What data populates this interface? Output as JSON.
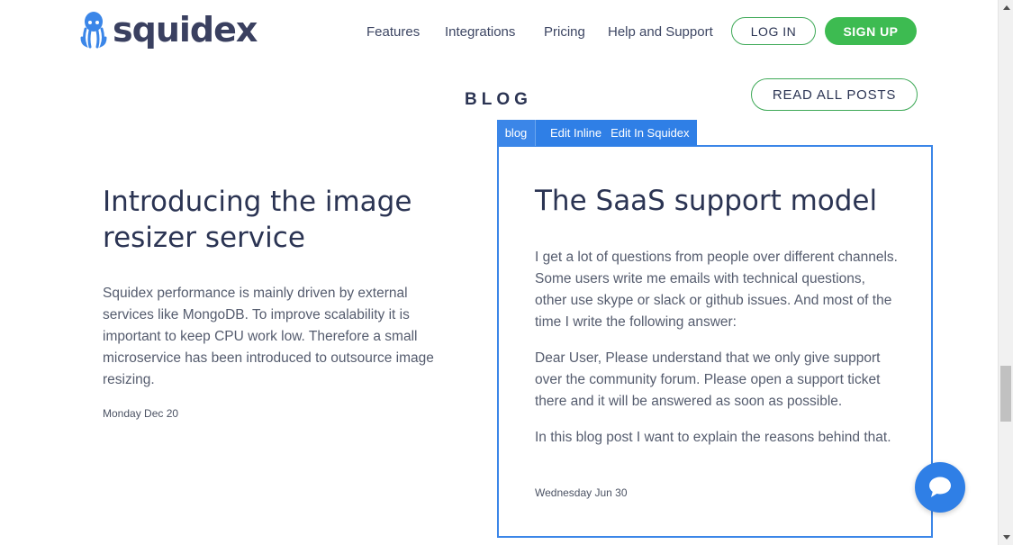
{
  "header": {
    "logo_text": "squidex",
    "nav": [
      "Features",
      "Integrations",
      "Pricing",
      "Help and Support"
    ],
    "login_label": "LOG IN",
    "signup_label": "SIGN UP"
  },
  "section": {
    "title": "BLOG",
    "read_all_label": "READ ALL POSTS"
  },
  "edit_toolbar": {
    "tag": "blog",
    "edit_inline": "Edit Inline",
    "edit_in_squidex": "Edit In Squidex"
  },
  "posts": [
    {
      "title": "Introducing the image resizer service",
      "body": "Squidex performance is mainly driven by external services like MongoDB. To improve scalability it is important to keep CPU work low. Therefore a small microservice has been introduced to outsource image resizing.",
      "date": "Monday Dec 20"
    },
    {
      "title": "The SaaS support model",
      "paragraphs": [
        "I get a lot of questions from people over different channels. Some users write me emails with technical questions, other use skype or slack or github issues. And most of the time I write the following answer:",
        "Dear User, Please understand that we only give support over the community forum. Please open a support ticket there and it will be answered as soon as possible.",
        "In this blog post I want to explain the reasons behind that."
      ],
      "date": "Wednesday Jun 30"
    }
  ],
  "colors": {
    "brand_green": "#3dbb51",
    "accent_blue": "#2f7fe6",
    "heading": "#2b3453",
    "body_text": "#555c6e"
  },
  "icons": {
    "logo": "squid-logo-icon",
    "chat": "chat-bubble-icon"
  }
}
